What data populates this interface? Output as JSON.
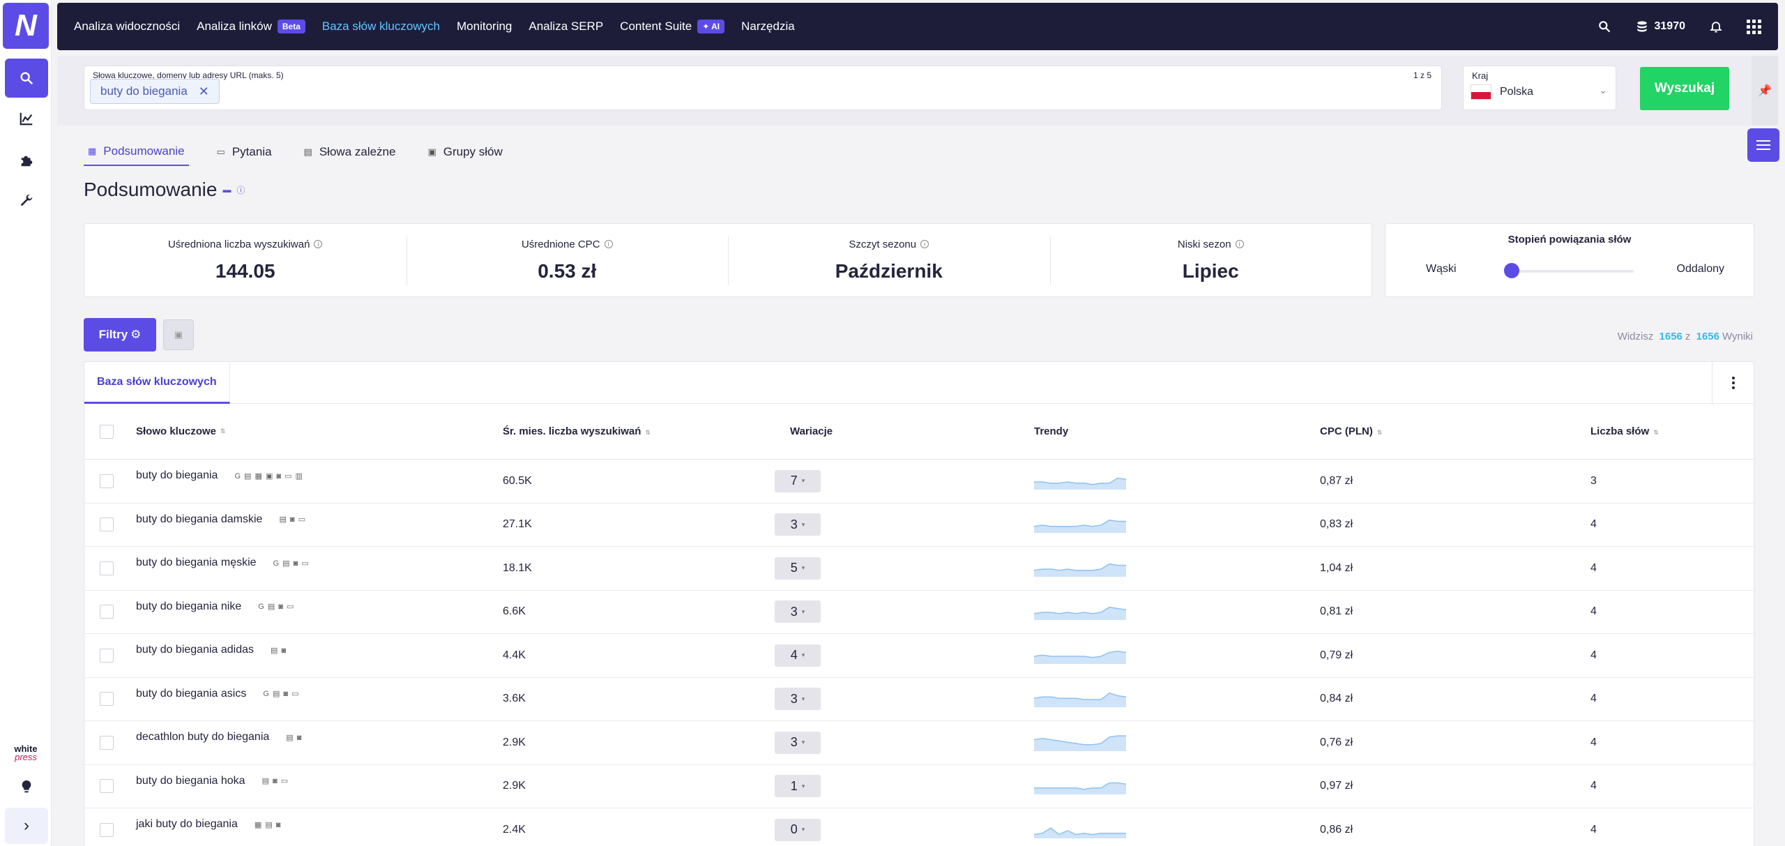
{
  "app": {
    "logo_text": "N"
  },
  "nav": [
    {
      "label": "Analiza widoczności"
    },
    {
      "label": "Analiza linków",
      "badge": "Beta"
    },
    {
      "label": "Baza słów kluczowych",
      "active": true
    },
    {
      "label": "Monitoring"
    },
    {
      "label": "Analiza SERP"
    },
    {
      "label": "Content Suite",
      "badge": "✦ AI"
    },
    {
      "label": "Narzędzia"
    }
  ],
  "topbar": {
    "credits": "31970"
  },
  "sidebar": {
    "items": [
      "search-icon",
      "chart-icon",
      "puzzle-icon",
      "wrench-icon"
    ],
    "brand": {
      "line1": "white",
      "line2": "press"
    },
    "expand": "›"
  },
  "search": {
    "label": "Słowa kluczowe, domeny lub adresy URL (maks. 5)",
    "count": "1 z 5",
    "chip": "buty do biegania",
    "chip_remove": "✕",
    "country_label": "Kraj",
    "country": "Polska",
    "button": "Wyszukaj"
  },
  "tabs": [
    {
      "label": "Podsumowanie",
      "active": true
    },
    {
      "label": "Pytania"
    },
    {
      "label": "Słowa zależne"
    },
    {
      "label": "Grupy słów"
    }
  ],
  "page_title": "Podsumowanie",
  "stats": [
    {
      "label": "Uśredniona liczba wyszukiwań",
      "value": "144.05"
    },
    {
      "label": "Uśrednione CPC",
      "value": "0.53 zł"
    },
    {
      "label": "Szczyt sezonu",
      "value": "Październik"
    },
    {
      "label": "Niski sezon",
      "value": "Lipiec"
    }
  ],
  "relation": {
    "title": "Stopień powiązania słów",
    "left": "Wąski",
    "right": "Oddalony",
    "level": 0
  },
  "filters": {
    "button": "Filtry",
    "results_prefix": "Widzisz",
    "shown": "1656",
    "of": "z",
    "total": "1656",
    "suffix": "Wyniki"
  },
  "table": {
    "tab": "Baza słów kluczowych",
    "headers": {
      "keyword": "Słowo kluczowe",
      "volume": "Śr. mies. liczba wyszukiwań",
      "variations": "Wariacje",
      "trends": "Trendy",
      "cpc": "CPC (PLN)",
      "words": "Liczba słów"
    },
    "rows": [
      {
        "keyword": "buty do biegania",
        "serp": "G ▤ ▦ ▣ ◙ ▭ ▥",
        "volume": "60.5K",
        "variations": "7",
        "cpc": "0,87 zł",
        "words": "3",
        "trend": [
          6,
          6,
          5,
          5,
          6,
          5,
          5,
          4,
          5,
          5,
          9,
          8
        ]
      },
      {
        "keyword": "buty do biegania damskie",
        "serp": "▤ ◙ ▭",
        "volume": "27.1K",
        "variations": "3",
        "cpc": "0,83 zł",
        "words": "4",
        "trend": [
          5,
          6,
          5,
          5,
          5,
          5,
          6,
          5,
          6,
          10,
          9,
          9
        ]
      },
      {
        "keyword": "buty do biegania męskie",
        "serp": "G ▤ ◙ ▭",
        "volume": "18.1K",
        "variations": "5",
        "cpc": "1,04 zł",
        "words": "4",
        "trend": [
          5,
          6,
          6,
          5,
          6,
          5,
          5,
          5,
          6,
          10,
          9,
          9
        ]
      },
      {
        "keyword": "buty do biegania nike",
        "serp": "G ▤ ◙ ▭",
        "volume": "6.6K",
        "variations": "3",
        "cpc": "0,81 zł",
        "words": "4",
        "trend": [
          5,
          6,
          6,
          5,
          6,
          5,
          6,
          5,
          6,
          10,
          9,
          8
        ]
      },
      {
        "keyword": "buty do biegania adidas",
        "serp": "▤ ◙",
        "volume": "4.4K",
        "variations": "4",
        "cpc": "0,79 zł",
        "words": "4",
        "trend": [
          6,
          7,
          6,
          6,
          6,
          6,
          6,
          5,
          6,
          9,
          10,
          9
        ]
      },
      {
        "keyword": "buty do biegania asics",
        "serp": "G ▤ ◙ ▭",
        "volume": "3.6K",
        "variations": "3",
        "cpc": "0,84 zł",
        "words": "4",
        "trend": [
          7,
          8,
          8,
          7,
          7,
          7,
          6,
          6,
          6,
          11,
          9,
          8
        ]
      },
      {
        "keyword": "decathlon buty do biegania",
        "serp": "▤ ◙",
        "volume": "2.9K",
        "variations": "3",
        "cpc": "0,76 zł",
        "words": "4",
        "trend": [
          9,
          10,
          9,
          8,
          7,
          6,
          5,
          5,
          6,
          11,
          12,
          12
        ]
      },
      {
        "keyword": "buty do biegania hoka",
        "serp": "▤ ◙ ▭",
        "volume": "2.9K",
        "variations": "1",
        "cpc": "0,97 zł",
        "words": "4",
        "trend": [
          5,
          5,
          5,
          5,
          5,
          5,
          4,
          5,
          5,
          9,
          9,
          8
        ]
      },
      {
        "keyword": "jaki buty do biegania",
        "serp": "▦ ▤ ◙",
        "volume": "2.4K",
        "variations": "0",
        "cpc": "0,86 zł",
        "words": "4",
        "trend": [
          3,
          4,
          8,
          3,
          6,
          3,
          4,
          3,
          4,
          4,
          4,
          4
        ]
      }
    ]
  },
  "colors": {
    "accent": "#5b4ce6",
    "nav_bg": "#1d1d3a",
    "search_btn": "#22d365",
    "link": "#63c4ff",
    "spark": "#8ec2f0"
  }
}
